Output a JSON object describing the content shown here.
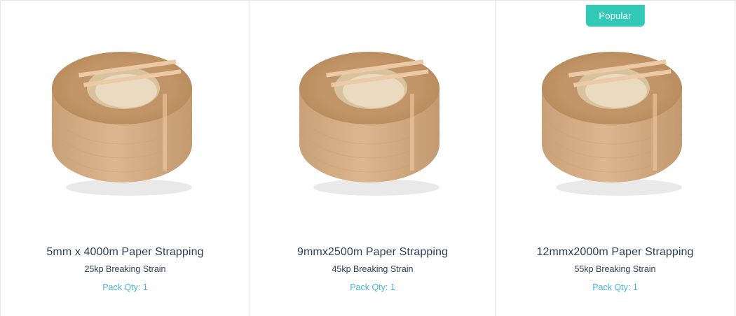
{
  "products": [
    {
      "title": "5mm x 4000m Paper Strapping",
      "strain": "25kp Breaking Strain",
      "pack_qty": "Pack Qty: 1",
      "badge": null,
      "image_icon": "paper-strapping-coil"
    },
    {
      "title": "9mmx2500m Paper Strapping",
      "strain": "45kp Breaking Strain",
      "pack_qty": "Pack Qty: 1",
      "badge": null,
      "image_icon": "paper-strapping-coil"
    },
    {
      "title": "12mmx2000m Paper Strapping",
      "strain": "55kp Breaking Strain",
      "pack_qty": "Pack Qty: 1",
      "badge": "Popular",
      "image_icon": "paper-strapping-coil"
    }
  ],
  "colors": {
    "badge_bg": "#33c9b7",
    "title_text": "#2b3f57",
    "pack_qty_text": "#4ab3e2",
    "divider": "#e6e6e6"
  }
}
